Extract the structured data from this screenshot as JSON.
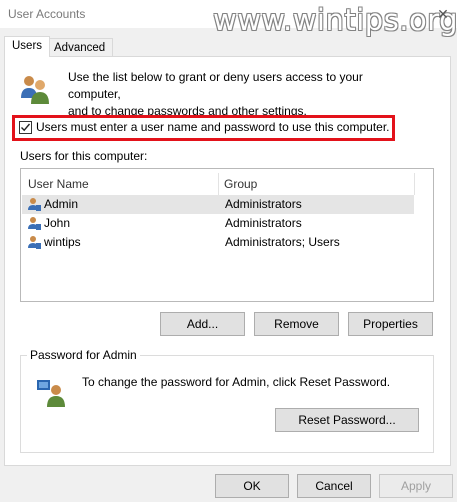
{
  "window": {
    "title": "User Accounts",
    "watermark": "www.wintips.org",
    "close_glyph": "✕"
  },
  "tabs": [
    {
      "label": "Users"
    },
    {
      "label": "Advanced"
    }
  ],
  "info": {
    "line1": "Use the list below to grant or deny users access to your computer,",
    "line2": "and to change passwords and other settings."
  },
  "checkbox": {
    "label": "Users must enter a user name and password to use this computer.",
    "checked": true
  },
  "users_label": "Users for this computer:",
  "table": {
    "columns": [
      "User Name",
      "Group"
    ],
    "rows": [
      {
        "name": "Admin",
        "group": "Administrators"
      },
      {
        "name": "John",
        "group": "Administrators"
      },
      {
        "name": "wintips",
        "group": "Administrators; Users"
      }
    ]
  },
  "buttons": {
    "add": "Add...",
    "remove": "Remove",
    "properties": "Properties"
  },
  "password_group": {
    "title": "Password for Admin",
    "text": "To change the password for Admin, click Reset Password.",
    "reset_button": "Reset Password..."
  },
  "footer": {
    "ok": "OK",
    "cancel": "Cancel",
    "apply": "Apply"
  },
  "colors": {
    "highlight_box": "#e3121a",
    "selected_row": "#e5e5e5"
  }
}
